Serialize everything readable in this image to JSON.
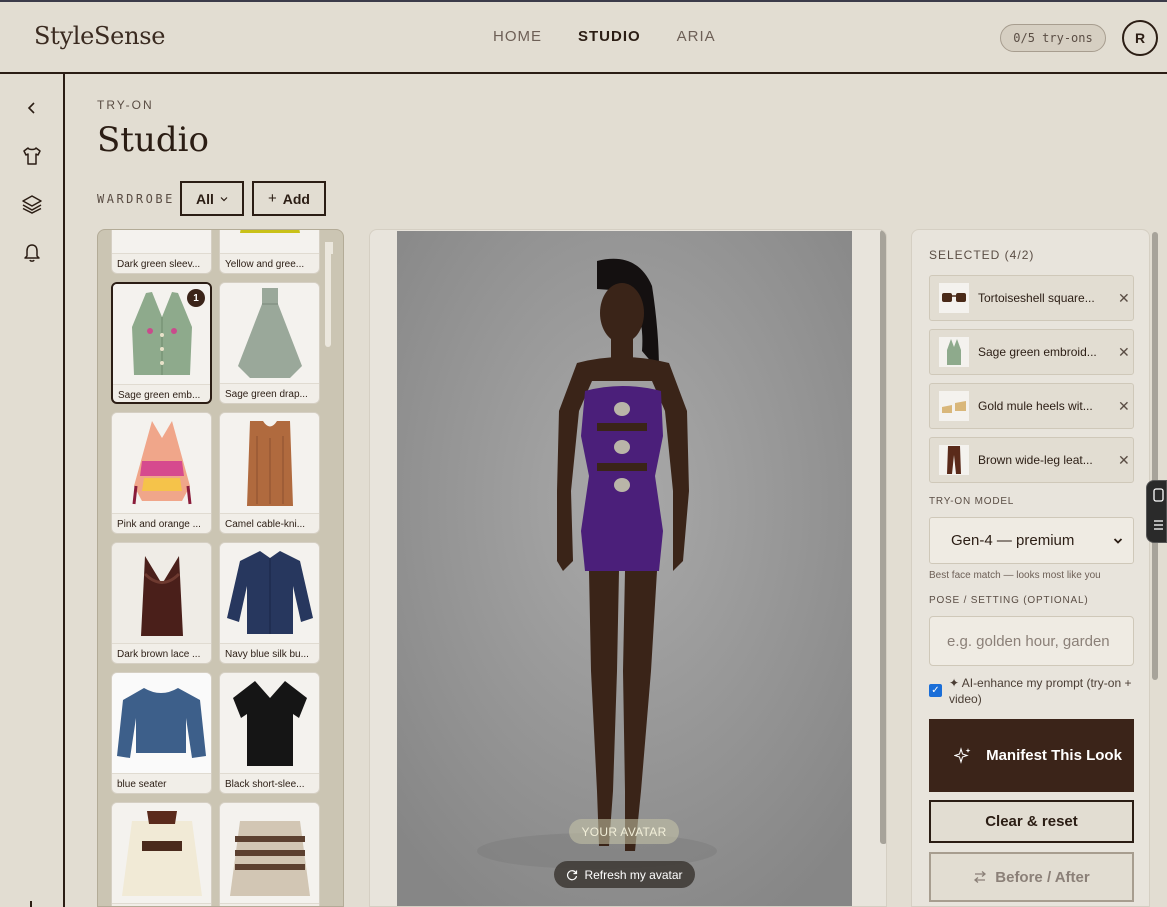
{
  "app": {
    "logo": "StyleSense"
  },
  "nav": {
    "items": [
      "HOME",
      "STUDIO",
      "ARIA"
    ],
    "active": "STUDIO",
    "tryons": "0/5 try-ons",
    "avatar_initial": "R"
  },
  "header": {
    "eyebrow": "TRY-ON",
    "title": "Studio"
  },
  "wardrobe": {
    "label": "WARDROBE",
    "filter": "All",
    "add_label": "Add",
    "items": [
      {
        "label": "Dark green sleev...",
        "selected": false
      },
      {
        "label": "Yellow and gree...",
        "selected": false
      },
      {
        "label": "Sage green emb...",
        "selected": true,
        "badge": "1"
      },
      {
        "label": "Sage green drap...",
        "selected": false
      },
      {
        "label": "Pink and orange ...",
        "selected": false
      },
      {
        "label": "Camel cable-kni...",
        "selected": false
      },
      {
        "label": "Dark brown lace ...",
        "selected": false
      },
      {
        "label": "Navy blue silk bu...",
        "selected": false
      },
      {
        "label": "blue seater",
        "selected": false
      },
      {
        "label": "Black short-slee...",
        "selected": false
      },
      {
        "label": "",
        "selected": false
      },
      {
        "label": "",
        "selected": false
      }
    ]
  },
  "stage": {
    "avatar_tag": "YOUR AVATAR",
    "refresh_label": "Refresh my avatar"
  },
  "panel": {
    "selected_title": "SELECTED (4/2)",
    "selected": [
      {
        "name": "Tortoiseshell square..."
      },
      {
        "name": "Sage green embroid..."
      },
      {
        "name": "Gold mule heels wit..."
      },
      {
        "name": "Brown wide-leg leat..."
      }
    ],
    "model_label": "TRY-ON MODEL",
    "model_value": "Gen-4 — premium",
    "model_hint": "Best face match — looks most like you",
    "pose_label": "POSE / SETTING (OPTIONAL)",
    "pose_placeholder": "e.g. golden hour, garden",
    "enhance_label": "✦ AI-enhance my prompt (try-on + video)",
    "manifest_label": "Manifest This Look",
    "clear_label": "Clear & reset",
    "before_after_label": "Before / After"
  },
  "colors": {
    "background": "#e2ddd2",
    "ink": "#2b1d14",
    "accent_dark": "#3b2419",
    "dress_purple": "#4b1f7a"
  }
}
